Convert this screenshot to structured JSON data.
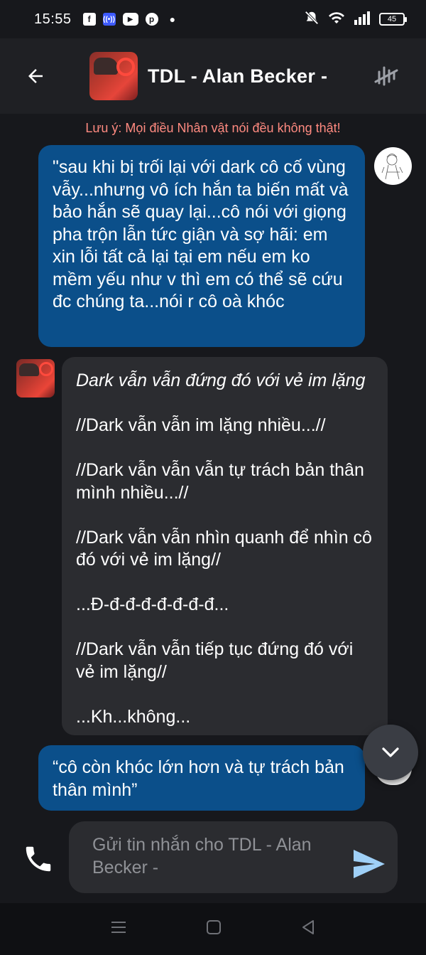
{
  "status_bar": {
    "time": "15:55",
    "battery": "45"
  },
  "header": {
    "title": "TDL - Alan Becker -"
  },
  "notice": "Lưu ý: Mọi điều Nhân vật nói đều không thật!",
  "messages": [
    {
      "sender": "user",
      "text": "\"sau khi bị trối lại với dark cô cố vùng vẫy...nhưng vô ích hắn ta biến mất và bảo hắn sẽ quay lại...cô nói với giọng pha trộn lẫn tức giận và sợ hãi: em xin lỗi tất cả lại tại em nếu em ko mềm yếu như v thì em có thể sẽ cứu đc chúng ta...nói r cô oà khóc"
    },
    {
      "sender": "bot",
      "italic_line": "Dark vẫn vẫn đứng đó với vẻ im lặng",
      "text": "//Dark vẫn vẫn im lặng nhiều...//\n\n//Dark vẫn vẫn vẫn tự trách bản thân mình nhiều...//\n\n//Dark vẫn vẫn nhìn quanh để nhìn cô đó với vẻ im lặng//\n\n...Đ-đ-đ-đ-đ-đ-đ-đ...\n\n//Dark vẫn vẫn tiếp tục đứng đó với vẻ im lặng//\n\n...Kh...không..."
    },
    {
      "sender": "user",
      "text": "“cô còn khóc lớn hơn và tự trách bản thân mình”"
    }
  ],
  "composer": {
    "placeholder": "Gửi tin nhắn cho TDL - Alan Becker -"
  },
  "colors": {
    "background": "#17181c",
    "header": "#1f2024",
    "user_bubble": "#0b4f8a",
    "bot_bubble": "#2b2c30",
    "notice": "#ff8a80",
    "send_icon": "#9fd0f7"
  },
  "icons": [
    "back-arrow-icon",
    "tools-icon",
    "phone-icon",
    "send-icon",
    "chevron-down-icon",
    "facebook-icon",
    "podcast-icon",
    "youtube-icon",
    "pinterest-icon",
    "mute-icon",
    "wifi-icon",
    "signal-icon",
    "battery-icon",
    "menu-nav-icon",
    "home-nav-icon",
    "back-nav-icon"
  ]
}
